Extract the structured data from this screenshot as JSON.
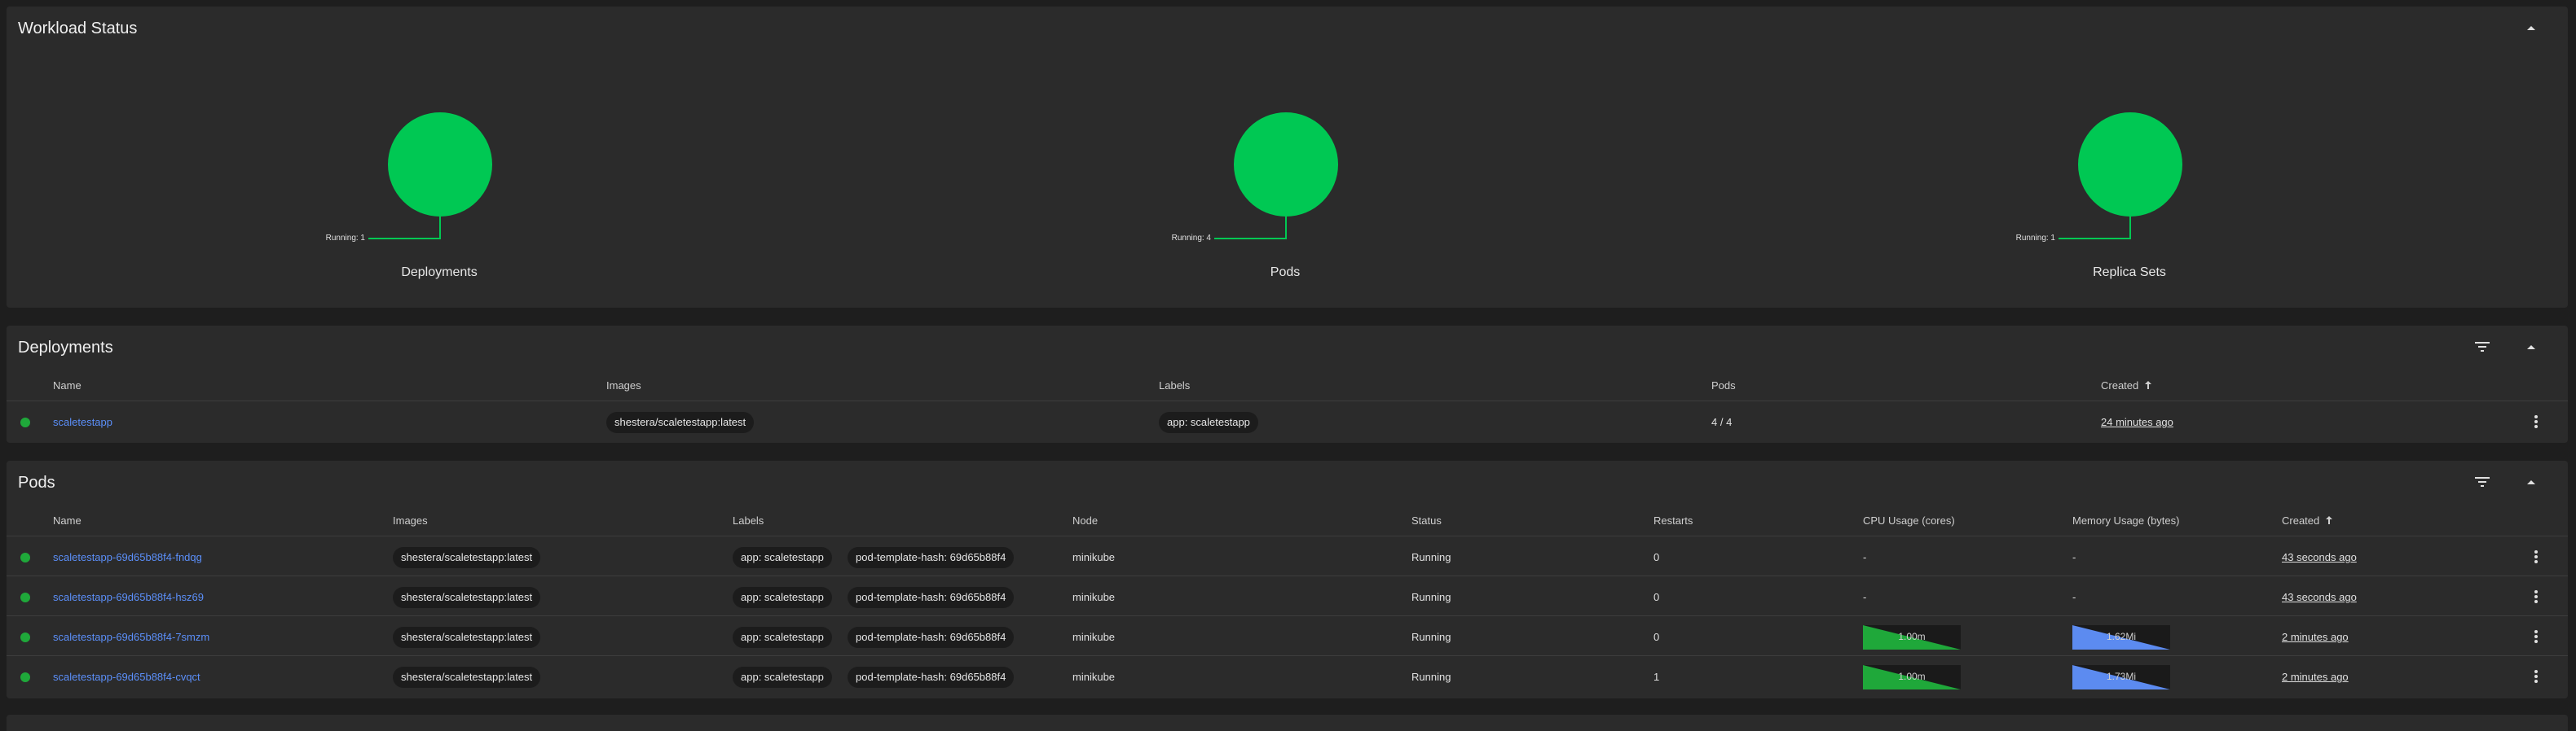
{
  "workload_status": {
    "title": "Workload Status",
    "items": [
      {
        "label": "Deployments",
        "running": "Running: 1"
      },
      {
        "label": "Pods",
        "running": "Running: 4"
      },
      {
        "label": "Replica Sets",
        "running": "Running: 1"
      }
    ],
    "running_color": "#00c853"
  },
  "deployments": {
    "title": "Deployments",
    "columns": [
      "Name",
      "Images",
      "Labels",
      "Pods",
      "Created"
    ],
    "rows": [
      {
        "name": "scaletestapp",
        "image": "shestera/scaletestapp:latest",
        "label": "app: scaletestapp",
        "pods": "4 / 4",
        "created": "24 minutes ago"
      }
    ]
  },
  "pods": {
    "title": "Pods",
    "columns": [
      "Name",
      "Images",
      "Labels",
      "Node",
      "Status",
      "Restarts",
      "CPU Usage (cores)",
      "Memory Usage (bytes)",
      "Created"
    ],
    "rows": [
      {
        "name": "scaletestapp-69d65b88f4-fndqg",
        "image": "shestera/scaletestapp:latest",
        "label1": "app: scaletestapp",
        "label2": "pod-template-hash: 69d65b88f4",
        "node": "minikube",
        "status": "Running",
        "restarts": "0",
        "cpu": "-",
        "memory": "-",
        "created": "43 seconds ago"
      },
      {
        "name": "scaletestapp-69d65b88f4-hsz69",
        "image": "shestera/scaletestapp:latest",
        "label1": "app: scaletestapp",
        "label2": "pod-template-hash: 69d65b88f4",
        "node": "minikube",
        "status": "Running",
        "restarts": "0",
        "cpu": "-",
        "memory": "-",
        "created": "43 seconds ago"
      },
      {
        "name": "scaletestapp-69d65b88f4-7smzm",
        "image": "shestera/scaletestapp:latest",
        "label1": "app: scaletestapp",
        "label2": "pod-template-hash: 69d65b88f4",
        "node": "minikube",
        "status": "Running",
        "restarts": "0",
        "cpu": "1.00m",
        "memory": "1.62Mi",
        "created": "2 minutes ago"
      },
      {
        "name": "scaletestapp-69d65b88f4-cvqct",
        "image": "shestera/scaletestapp:latest",
        "label1": "app: scaletestapp",
        "label2": "pod-template-hash: 69d65b88f4",
        "node": "minikube",
        "status": "Running",
        "restarts": "1",
        "cpu": "1.00m",
        "memory": "1.73Mi",
        "created": "2 minutes ago"
      }
    ]
  },
  "icons": {
    "collapse": "chevron-up-icon",
    "filter": "filter-icon",
    "actions": "more-vert-icon",
    "sort": "arrow-up-icon"
  },
  "colors": {
    "link": "#5b8ff9",
    "status_ok": "#1fa83a",
    "cpu_spark": "#1fa83a",
    "memory_spark": "#5c8bf0"
  }
}
